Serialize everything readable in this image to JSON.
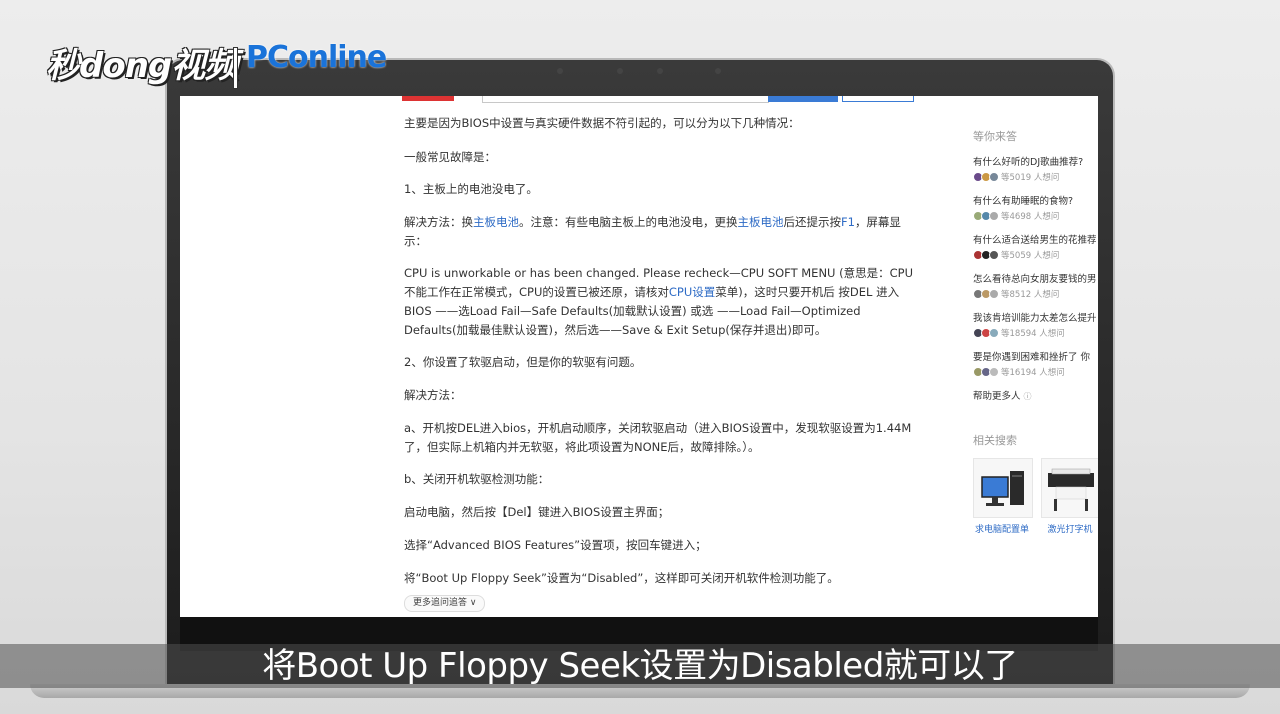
{
  "watermark": {
    "brand": "秒dong视频",
    "partner": "PConline"
  },
  "article": {
    "intro": "主要是因为BIOS中设置与真实硬件数据不符引起的，可以分为以下几种情况：",
    "common_faults": "一般常见故障是：",
    "item1": "1、主板上的电池没电了。",
    "solution1_a": "解决方法：换",
    "solution1_link1": "主板电池",
    "solution1_b": "。注意：有些电脑主板上的电池没电，更换",
    "solution1_link2": "主板电池",
    "solution1_c": "后还提示按",
    "solution1_link3": "F1",
    "solution1_d": "，屏幕显示：",
    "cpu_a": "CPU is unworkable or has been changed. Please recheck—CPU SOFT MENU (意思是：CPU不能工作在正常模式，CPU的设置已被还原，请核对",
    "cpu_link": "CPU设置",
    "cpu_b": "菜单)，这时只要开机后 按DEL 进入 BIOS ——选Load Fail—Safe Defaults(加载默认设置) 或选 ——Load Fail—Optimized Defaults(加载最佳默认设置)，然后选——Save & Exit Setup(保存并退出)即可。",
    "item2": "2、你设置了软驱启动，但是你的软驱有问题。",
    "solution2": "解决方法：",
    "step_a": "a、开机按DEL进入bios，开机启动顺序，关闭软驱启动（进入BIOS设置中，发现软驱设置为1.44M了，但实际上机箱内并无软驱，将此项设置为NONE后，故障排除。）。",
    "step_b": "b、关闭开机软驱检测功能：",
    "boot": "启动电脑，然后按【Del】键进入BIOS设置主界面；",
    "select": "选择“Advanced BIOS Features”设置项，按回车键进入；",
    "set": "将“Boot Up Floppy Seek”设置为“Disabled”，这样即可关闭开机软件检测功能了。",
    "more_button": "更多追问追答 ∨"
  },
  "sidebar": {
    "title": "等你来答",
    "questions": [
      {
        "text": "有什么好听的DJ歌曲推荐?",
        "meta": "等5019 人想问"
      },
      {
        "text": "有什么有助睡眠的食物?",
        "meta": "等4698 人想问"
      },
      {
        "text": "有什么适合送给男生的花推荐",
        "meta": "等5059 人想问"
      },
      {
        "text": "怎么看待总向女朋友要钱的男",
        "meta": "等8512 人想问"
      },
      {
        "text": "我该肯培训能力太差怎么提升",
        "meta": "等18594 人想问"
      },
      {
        "text": "要是你遇到困难和挫折了 你",
        "meta": "等16194 人想问"
      }
    ],
    "help": "帮助更多人",
    "related_title": "相关搜索",
    "related": [
      {
        "label": "求电脑配置单"
      },
      {
        "label": "激光打字机"
      }
    ]
  },
  "subtitle": "将Boot Up Floppy Seek设置为Disabled就可以了",
  "colors": {
    "link": "#2e6bc5",
    "accent_blue": "#3a7bd5",
    "brand_blue": "#1a73d9"
  }
}
